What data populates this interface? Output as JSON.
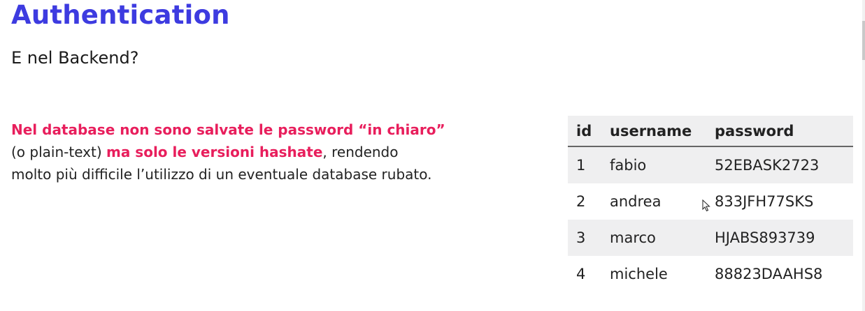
{
  "slide": {
    "title": "Authentication",
    "subtitle": "E nel Backend?",
    "paragraph": {
      "highlight1": "Nel database non sono salvate le password “in chiaro”",
      "plain1": "(o plain-text) ",
      "highlight2": "ma solo le versioni hashate",
      "plain2": ", rendendo",
      "plain3": "molto più difficile l’utilizzo di un eventuale database rubato."
    }
  },
  "table": {
    "headers": [
      "id",
      "username",
      "password"
    ],
    "rows": [
      [
        "1",
        "fabio",
        "52EBASK2723"
      ],
      [
        "2",
        "andrea",
        "833JFH77SKS"
      ],
      [
        "3",
        "marco",
        "HJABS893739"
      ],
      [
        "4",
        "michele",
        "88823DAAHS8"
      ]
    ]
  },
  "colors": {
    "title": "#3d3be0",
    "highlight": "#e81e5c",
    "table_stripe": "#efeff0"
  },
  "icons": {
    "cursor": "mouse-pointer-icon"
  }
}
